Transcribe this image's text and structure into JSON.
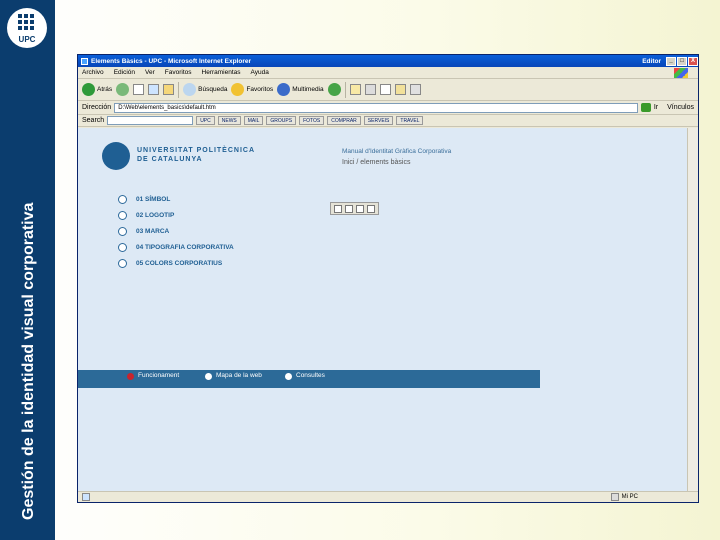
{
  "slide": {
    "vertical_title": "Gestión de la identidad visual corporativa",
    "logo_text": "UPC",
    "band_color": "#0b3d6e"
  },
  "window": {
    "title": "Elements Bàsics - UPC - Microsoft Internet Explorer",
    "extra_label": "Editor",
    "min_button": "_",
    "max_button": "□",
    "close_button": "X"
  },
  "menubar": {
    "items": [
      "Archivo",
      "Edición",
      "Ver",
      "Favoritos",
      "Herramientas",
      "Ayuda"
    ]
  },
  "toolbar": {
    "back_label": "Atrás",
    "search_label": "Búsqueda",
    "favorites_label": "Favoritos",
    "multimedia_label": "Multimedia"
  },
  "addressbar": {
    "label": "Dirección",
    "value": "D:\\Web\\elements_basics\\default.htm",
    "go_label": "Ir",
    "links_label": "Vínculos"
  },
  "searchbar": {
    "label": "Search",
    "links": [
      "UPC",
      "NEWS",
      "MAIL",
      "GROUPS",
      "FOTOS",
      "COMPRAR",
      "SERVEIS",
      "TRAVEL"
    ]
  },
  "page": {
    "university_line1": "UNIVERSITAT POLITÈCNICA",
    "university_line2": "DE CATALUNYA",
    "manual_title": "Manual d'Identitat Gràfica Corporativa",
    "section_path": "Inici / elements bàsics",
    "menu_items": [
      "01 SÍMBOL",
      "02 LOGOTIP",
      "03 MARCA",
      "04 TIPOGRAFIA CORPORATIVA",
      "05 COLORS CORPORATIUS"
    ],
    "nav_items": [
      "Funcionament",
      "Mapa de la web",
      "Consultes"
    ]
  },
  "statusbar": {
    "left_text": "",
    "right_text": "Mi PC"
  }
}
